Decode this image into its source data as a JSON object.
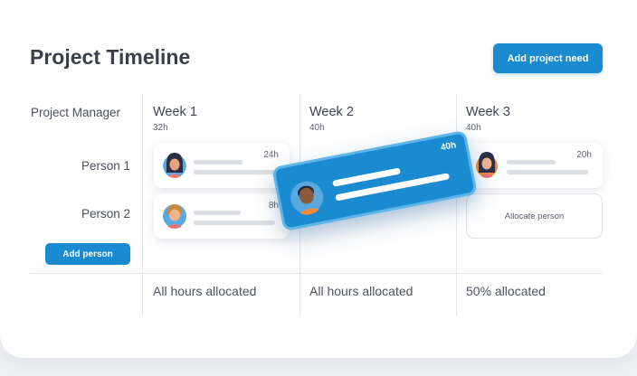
{
  "header": {
    "title": "Project Timeline",
    "add_project_need": "Add project need"
  },
  "left_column": {
    "header": "Project Manager",
    "people": [
      "Person 1",
      "Person 2"
    ],
    "add_person": "Add person"
  },
  "weeks": [
    {
      "title": "Week 1",
      "hours": "32h",
      "footer": "All hours allocated"
    },
    {
      "title": "Week 2",
      "hours": "40h",
      "footer": "All hours allocated"
    },
    {
      "title": "Week 3",
      "hours": "40h",
      "footer": "50% allocated"
    }
  ],
  "cards": {
    "week1_person1_hours": "24h",
    "week1_person2_hours": "8h",
    "dragged_hours": "40h",
    "week3_person1_hours": "20h",
    "week3_allocate": "Allocate person"
  },
  "colors": {
    "accent": "#1a8bd0",
    "avatar_bg": "#5aa9de",
    "dragged_avatar_bg": "#f28a3a"
  }
}
